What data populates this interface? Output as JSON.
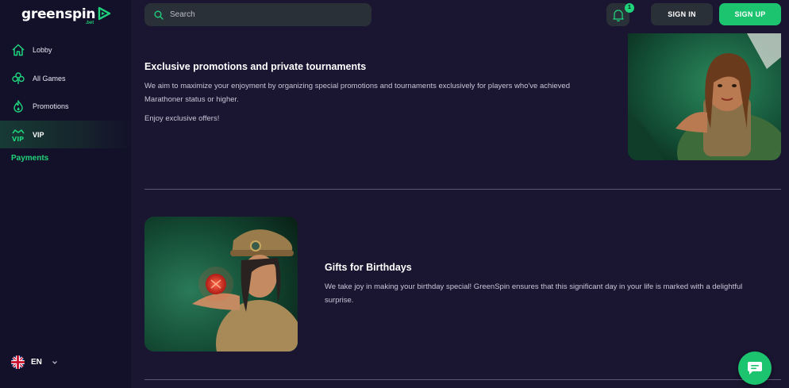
{
  "brand": {
    "name": "greenspin",
    "sub": ".bet"
  },
  "search": {
    "placeholder": "Search"
  },
  "header": {
    "notification_count": "1",
    "sign_in_label": "SIGN IN",
    "sign_up_label": "SIGN UP"
  },
  "sidebar": {
    "items": [
      {
        "label": "Lobby",
        "icon": "home-icon"
      },
      {
        "label": "All Games",
        "icon": "clover-icon"
      },
      {
        "label": "Promotions",
        "icon": "fire-icon"
      },
      {
        "label": "VIP",
        "icon": "vip-crown-icon",
        "active": true
      }
    ],
    "payments_label": "Payments",
    "language": "EN"
  },
  "sections": [
    {
      "title": "Exclusive promotions and private tournaments",
      "text": "We aim to maximize your enjoyment by organizing special promotions and tournaments exclusively for players who've achieved Marathoner status or higher.",
      "extra": "Enjoy exclusive offers!"
    },
    {
      "title": "Gifts for Birthdays",
      "text": "We take joy in making your birthday special! GreenSpin ensures that this significant day in your life is marked with a delightful surprise."
    }
  ],
  "colors": {
    "accent": "#1cc46f",
    "background": "#1a1530",
    "sidebar": "#13112a",
    "control": "#2a3038"
  }
}
